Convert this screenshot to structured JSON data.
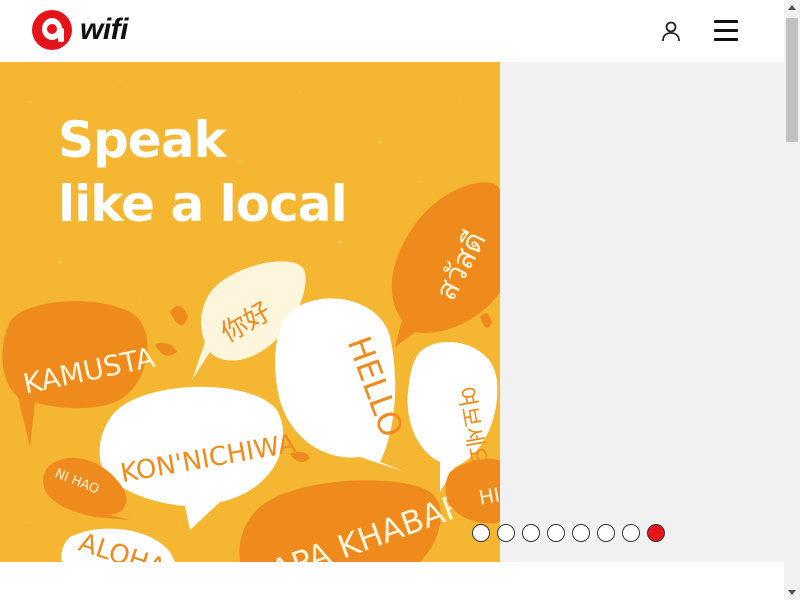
{
  "header": {
    "logo_text": "wifi",
    "icons": {
      "logo": "airasia-logo-icon",
      "user": "user-icon",
      "menu": "hamburger-menu-icon"
    }
  },
  "hero": {
    "headline_line1": "Speak",
    "headline_line2": "like a local",
    "bubble_words": [
      "KAMUSTA",
      "你好",
      "HELLO",
      "สวัสดี",
      "KON'NICHIWA",
      "여보세요",
      "NI HAO",
      "APA KHABAR",
      "ALOHA",
      "HI"
    ],
    "carousel": {
      "total": 8,
      "active_index": 7
    }
  },
  "colors": {
    "brand_red": "#e5131b",
    "slide_bg": "#f5b731",
    "bubble_orange": "#ef8a1c",
    "bubble_cream": "#fdf6dc"
  }
}
